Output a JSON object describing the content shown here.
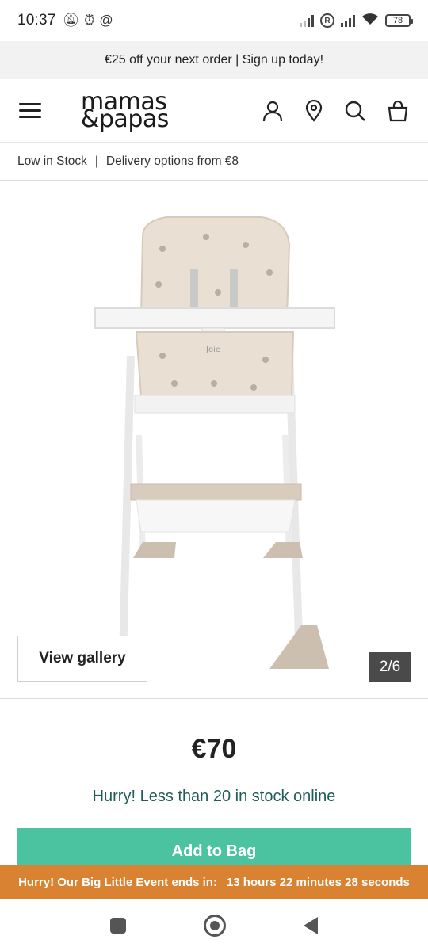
{
  "status_bar": {
    "time": "10:37",
    "left_icons": [
      "bell-off-icon",
      "alarm-icon",
      "at-sign-icon"
    ],
    "roaming": "R",
    "battery": "78"
  },
  "promo": {
    "text": "€25 off your next order | Sign up today!"
  },
  "header": {
    "logo_line1": "mamas",
    "logo_line2": "&papas",
    "icons": [
      "account-icon",
      "store-locator-icon",
      "search-icon",
      "bag-icon"
    ]
  },
  "stock_line": {
    "stock": "Low in Stock",
    "separator": "|",
    "delivery": "Delivery options from €8"
  },
  "gallery": {
    "view_gallery_label": "View gallery",
    "counter": "2/6",
    "brand_mark": "Joie"
  },
  "product": {
    "price": "€70",
    "stock_message": "Hurry! Less than 20 in stock online",
    "add_to_bag_label": "Add to Bag"
  },
  "countdown": {
    "label": "Hurry! Our Big Little Event ends in:",
    "time_left": "13 hours 22 minutes 28 seconds"
  },
  "colors": {
    "accent_green": "#4cc3a0",
    "countdown_orange": "#d98332",
    "stock_text_teal": "#1f5c5a"
  }
}
